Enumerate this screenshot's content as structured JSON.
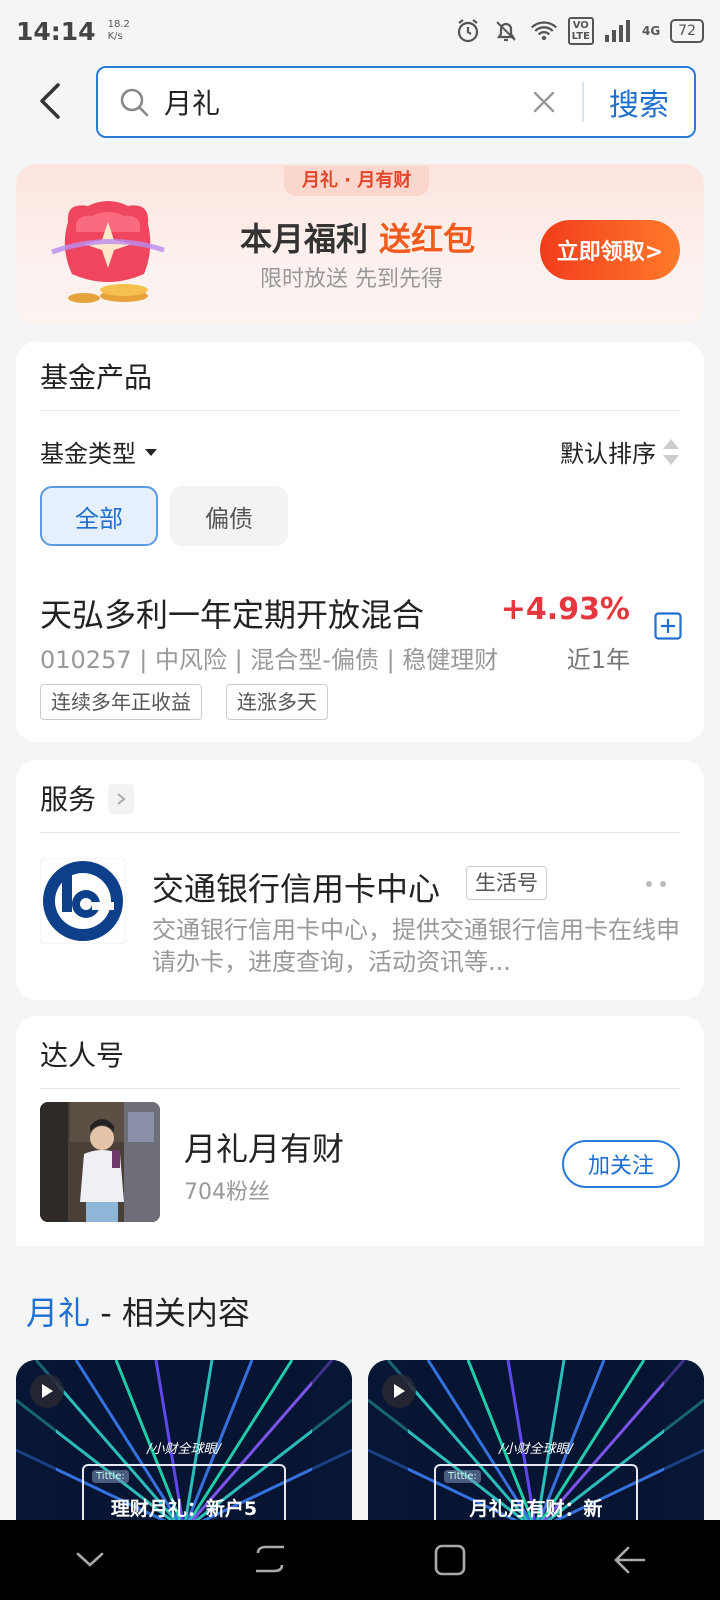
{
  "status_bar": {
    "time": "14:14",
    "net_speed_value": "18.2",
    "net_speed_unit": "K/s",
    "volte_top": "VO",
    "volte_bottom": "LTE",
    "network_type": "4G",
    "battery": "72"
  },
  "search": {
    "query": "月礼",
    "button_label": "搜索"
  },
  "promo": {
    "tag": "月礼 · 月有财",
    "title_main": "本月福利 ",
    "title_highlight": "送红包",
    "subtitle": "限时放送 先到先得",
    "cta": "立即领取>"
  },
  "fund_section": {
    "title": "基金产品",
    "filter_label": "基金类型",
    "sort_label": "默认排序",
    "chips": [
      "全部",
      "偏债"
    ],
    "item": {
      "name": "天弘多利一年定期开放混合",
      "rate": "+4.93%",
      "meta": "010257 | 中风险 | 混合型-偏债 | 稳健理财",
      "period": "近1年",
      "tags": [
        "连续多年正收益",
        "连涨多天"
      ]
    }
  },
  "service_section": {
    "title": "服务",
    "item": {
      "name": "交通银行信用卡中心",
      "badge": "生活号",
      "desc": "交通银行信用卡中心，提供交通银行信用卡在线申请办卡，进度查询，活动资讯等..."
    }
  },
  "talent_section": {
    "title": "达人号",
    "item": {
      "name": "月礼月有财",
      "fans": "704粉丝",
      "follow_label": "加关注"
    }
  },
  "related": {
    "keyword": "月礼",
    "suffix": " - 相关内容",
    "videos": [
      {
        "brand": "/小财全球眼/",
        "tag": "Tittle:",
        "caption": "理财月礼：新户5"
      },
      {
        "brand": "/小财全球眼/",
        "tag": "Tittle:",
        "caption": "月礼月有财：新"
      }
    ]
  },
  "colors": {
    "accent_blue": "#1f6fd1",
    "rate_red": "#e6363f",
    "promo_orange": "#f05a1d"
  }
}
